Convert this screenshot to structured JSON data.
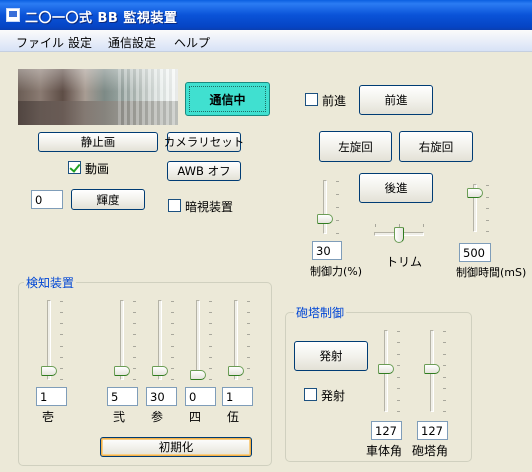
{
  "window": {
    "title": "二〇一〇式 BB 監視装置"
  },
  "menu": {
    "items": [
      "ファイル",
      "設定",
      "通信設定",
      "ヘルプ"
    ]
  },
  "camera": {
    "buttons": {
      "still": "静止画",
      "camera_reset": "カメラリセット",
      "awb_off": "AWB オフ",
      "brightness": "輝度"
    },
    "video_label": "動画",
    "video_checked": true,
    "night_label": "暗視装置",
    "night_checked": false,
    "brightness_value": "0"
  },
  "comm": {
    "button": "通信中"
  },
  "drive": {
    "forward_check_label": "前進",
    "forward_checked": false,
    "forward": "前進",
    "left": "左旋回",
    "right": "右旋回",
    "back": "後進",
    "power_value": "30",
    "power_label": "制御力(%)",
    "trim_label": "トリム",
    "time_value": "500",
    "time_label": "制御時間(mS)",
    "power_level": 0.2,
    "trim_level": 0.5,
    "time_level": 0.8
  },
  "detector": {
    "title": "検知装置",
    "sliders": [
      {
        "label": "壱",
        "value": "1",
        "level": 0.05
      },
      {
        "label": "弐",
        "value": "5",
        "level": 0.05
      },
      {
        "label": "参",
        "value": "30",
        "level": 0.05
      },
      {
        "label": "四",
        "value": "0",
        "level": 0.0
      },
      {
        "label": "伍",
        "value": "1",
        "level": 0.05
      }
    ],
    "init_button": "初期化"
  },
  "turret": {
    "title": "砲塔制御",
    "fire_button": "発射",
    "fire_check_label": "発射",
    "fire_checked": false,
    "body_angle_value": "127",
    "body_angle_label": "車体角",
    "body_level": 0.5,
    "turret_angle_value": "127",
    "turret_angle_label": "砲塔角",
    "turret_level": 0.5
  }
}
